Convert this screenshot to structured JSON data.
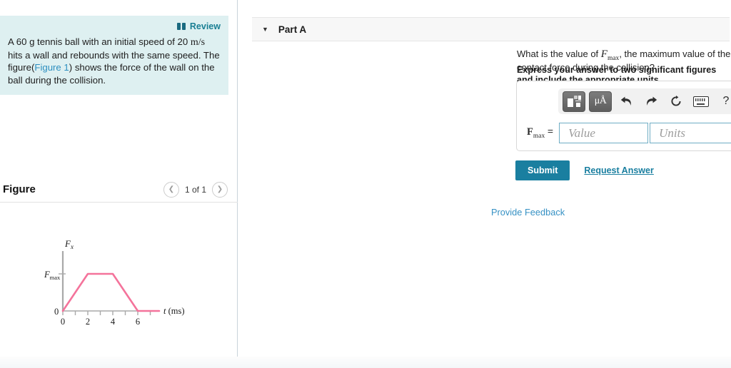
{
  "left_panel": {
    "review_label": "Review",
    "review_icon": "book-icon",
    "problem": {
      "part1": "A 60 g tennis ball with an initial speed of 20 ",
      "units": "m/s",
      "part2": " hits a wall and rebounds with the same speed. The figure(",
      "figure_link": "Figure 1",
      "part3": ") shows the force of the wall on the ball during the collision."
    },
    "figure": {
      "title": "Figure",
      "prev_icon": "chevron-left-icon",
      "next_icon": "chevron-right-icon",
      "counter": "1 of 1"
    }
  },
  "right_panel": {
    "part_header": {
      "caret_icon": "chevron-down-icon",
      "label": "Part A"
    },
    "question": {
      "before": "What is the value of ",
      "symbol": "F",
      "symbol_sub": "max",
      "after": ", the maximum value of the contact force during the collision?"
    },
    "instruction": "Express your answer to two significant figures and include the appropriate units.",
    "answer_widget": {
      "toolbar": [
        {
          "name": "math-template-icon",
          "label": ""
        },
        {
          "name": "units-icon",
          "label": "μÅ"
        },
        {
          "name": "undo-icon",
          "label": "↶"
        },
        {
          "name": "redo-icon",
          "label": "↷"
        },
        {
          "name": "reset-icon",
          "label": "↺"
        },
        {
          "name": "keyboard-icon",
          "label": ""
        },
        {
          "name": "help-icon",
          "label": "?"
        }
      ],
      "label_symbol": "F",
      "label_sub": "max",
      "label_eq": " =",
      "value_placeholder": "Value",
      "value": "",
      "units_placeholder": "Units",
      "units_value": ""
    },
    "submit_label": "Submit",
    "request_answer_label": "Request Answer",
    "provide_feedback_label": "Provide Feedback"
  },
  "colors": {
    "problem_bg": "#def0f1",
    "teal": "#1a7fa0",
    "link_blue": "#3691c4",
    "curve_pink": "#f4739b"
  },
  "chart_data": {
    "type": "line",
    "title": "",
    "xlabel": "t (ms)",
    "ylabel": "F_x",
    "x": [
      0,
      2,
      4,
      6,
      7
    ],
    "values": [
      0,
      1,
      1,
      0,
      0
    ],
    "xlim": [
      0,
      7
    ],
    "ylim": [
      0,
      1.25
    ],
    "xticks": [
      0,
      1,
      2,
      3,
      4,
      5,
      6,
      7
    ],
    "xticklabels": [
      "0",
      "",
      "2",
      "",
      "4",
      "",
      "6",
      ""
    ],
    "yticks": [
      0,
      1
    ],
    "yticklabels": [
      "0",
      "F_max"
    ],
    "y_axis_symbol": "F",
    "y_axis_sub": "x",
    "ymax_label_symbol": "F",
    "ymax_label_sub": "max",
    "origin_label": "0",
    "grid": false,
    "legend": false,
    "annotation": "Trapezoidal contact force: rises linearly 0-2 ms, constant at F_max 2-4 ms, falls linearly 4-6 ms, zero thereafter"
  }
}
